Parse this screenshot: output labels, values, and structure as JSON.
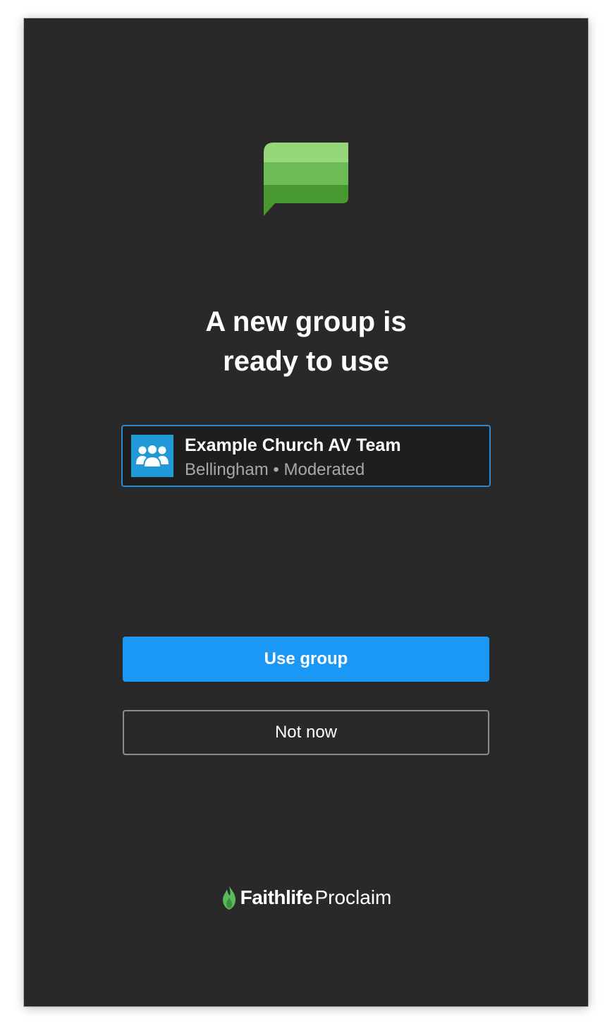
{
  "dialog": {
    "title_line1": "A new group is",
    "title_line2": "ready to use",
    "icon": "chat-bubble-icon"
  },
  "group": {
    "name": "Example Church AV Team",
    "location": "Bellingham",
    "separator": "•",
    "type": "Moderated",
    "avatar_icon": "group-people-icon"
  },
  "actions": {
    "primary_label": "Use group",
    "secondary_label": "Not now"
  },
  "brand": {
    "name_bold": "Faithlife",
    "name_light": "Proclaim",
    "icon": "flame-icon"
  },
  "colors": {
    "background": "#292929",
    "accent": "#1b98f5",
    "card_border": "#2d88cf",
    "avatar_bg": "#1f9ad6",
    "brand_green": "#5cb85c"
  }
}
